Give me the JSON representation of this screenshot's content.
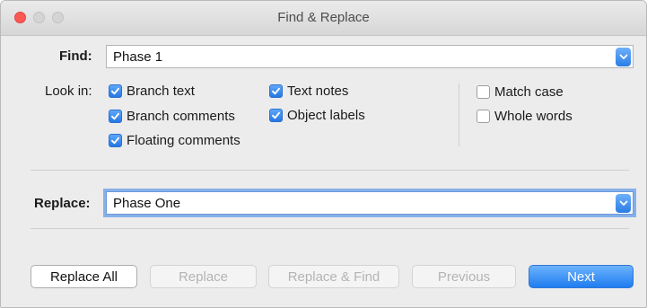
{
  "window": {
    "title": "Find & Replace"
  },
  "find": {
    "label": "Find:",
    "value": "Phase 1"
  },
  "look_in": {
    "label": "Look in:",
    "options": [
      {
        "label": "Branch text",
        "checked": true
      },
      {
        "label": "Branch comments",
        "checked": true
      },
      {
        "label": "Floating comments",
        "checked": true
      },
      {
        "label": "Text notes",
        "checked": true
      },
      {
        "label": "Object labels",
        "checked": true
      }
    ]
  },
  "match_options": [
    {
      "label": "Match case",
      "checked": false
    },
    {
      "label": "Whole words",
      "checked": false
    }
  ],
  "replace": {
    "label": "Replace:",
    "value": "Phase One"
  },
  "buttons": {
    "replace_all": "Replace All",
    "replace": "Replace",
    "replace_and_find": "Replace & Find",
    "previous": "Previous",
    "next": "Next"
  },
  "colors": {
    "accent": "#2a7de6",
    "close": "#fc5753",
    "focus_ring": "#86b0ea"
  }
}
